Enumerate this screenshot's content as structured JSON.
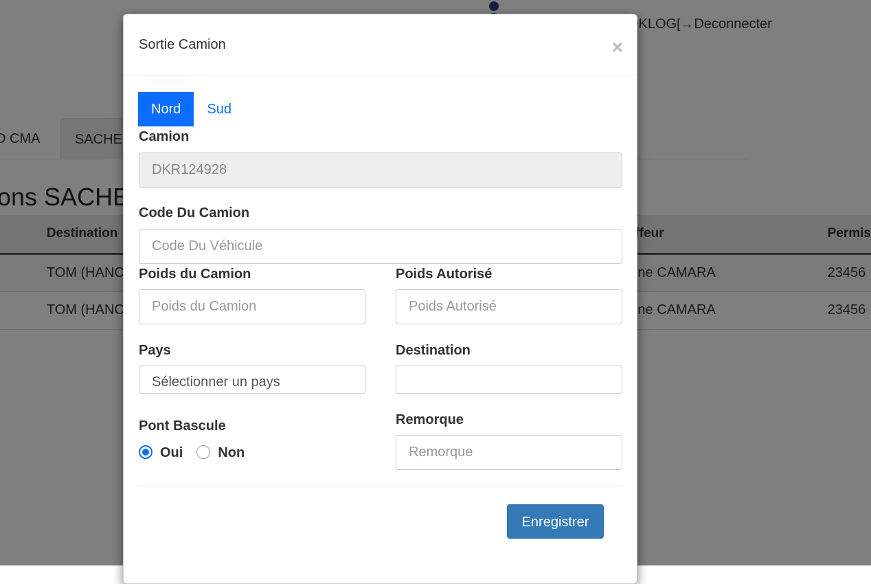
{
  "header": {
    "username": "OKLOG",
    "logout_label": "Deconnecter"
  },
  "nav_tabs": [
    "D CMA",
    "SACHE"
  ],
  "page_title": "ons SACHE",
  "table": {
    "columns": [
      "Destination",
      "uffeur",
      "Permis"
    ],
    "rows": [
      [
        "TOM (HANC",
        "nine CAMARA",
        "23456"
      ],
      [
        "TOM (HANC",
        "nine CAMARA",
        "23456"
      ]
    ]
  },
  "modal": {
    "title": "Sortie Camion",
    "close_symbol": "×",
    "tabs": [
      {
        "label": "Nord",
        "active": true
      },
      {
        "label": "Sud",
        "active": false
      }
    ],
    "fields": {
      "camion": {
        "label": "Camion",
        "value": "DKR124928"
      },
      "code_camion": {
        "label": "Code Du Camion",
        "placeholder": "Code Du Véhicule"
      },
      "poids_camion": {
        "label": "Poids du Camion",
        "placeholder": "Poids du Camion"
      },
      "poids_autorise": {
        "label": "Poids Autorisé",
        "placeholder": "Poids Autorisé"
      },
      "pays": {
        "label": "Pays",
        "selected": "Sélectionner un pays"
      },
      "destination": {
        "label": "Destination",
        "value": ""
      },
      "pont_bascule": {
        "label": "Pont Bascule",
        "options": [
          "Oui",
          "Non"
        ],
        "selected": "Oui"
      },
      "remorque": {
        "label": "Remorque",
        "placeholder": "Remorque"
      }
    },
    "save_label": "Enregistrer"
  },
  "colors": {
    "primary_tab": "#0d6efd",
    "save_button": "#337ab7"
  }
}
